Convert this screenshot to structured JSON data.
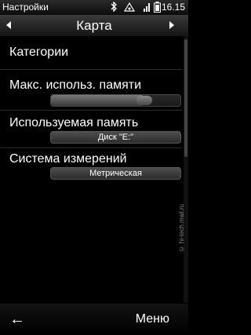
{
  "status_bar": {
    "app_name": "Настройки",
    "time": "16.15",
    "icons": [
      "bluetooth-icon",
      "signal-icon",
      "wifi-icon",
      "battery-icon"
    ]
  },
  "title_bar": {
    "title": "Карта",
    "prev_icon": "arrow-left-icon",
    "next_icon": "arrow-right-icon"
  },
  "settings": {
    "categories_label": "Категории",
    "max_memory": {
      "label": "Макс. использ. памяти",
      "slider_value_fraction": 0.75
    },
    "used_memory": {
      "label": "Используемая память",
      "value": "Диск \"E:\""
    },
    "measurement_system": {
      "label": "Система измерений",
      "value": "Метрическая"
    }
  },
  "watermark": "© hi-tech.mail.ru",
  "softkeys": {
    "back_icon": "back-arrow-icon",
    "back_glyph": "←",
    "menu_label": "Меню"
  },
  "colors": {
    "background": "#000000",
    "text": "#ffffff",
    "control": "#3c3c3c"
  }
}
